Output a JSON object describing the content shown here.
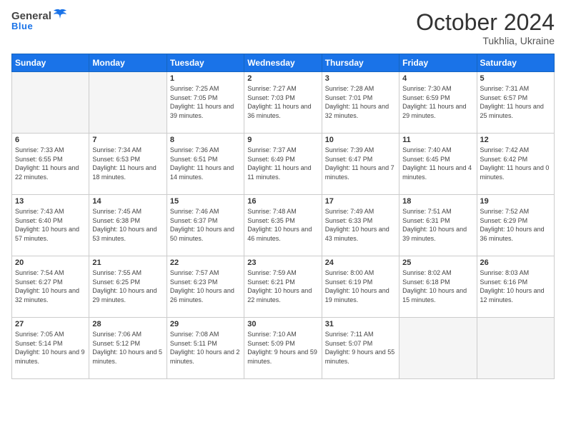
{
  "header": {
    "logo_general": "General",
    "logo_blue": "Blue",
    "month": "October 2024",
    "location": "Tukhlia, Ukraine"
  },
  "weekdays": [
    "Sunday",
    "Monday",
    "Tuesday",
    "Wednesday",
    "Thursday",
    "Friday",
    "Saturday"
  ],
  "weeks": [
    [
      {
        "day": "",
        "info": ""
      },
      {
        "day": "",
        "info": ""
      },
      {
        "day": "1",
        "info": "Sunrise: 7:25 AM\nSunset: 7:05 PM\nDaylight: 11 hours\nand 39 minutes."
      },
      {
        "day": "2",
        "info": "Sunrise: 7:27 AM\nSunset: 7:03 PM\nDaylight: 11 hours\nand 36 minutes."
      },
      {
        "day": "3",
        "info": "Sunrise: 7:28 AM\nSunset: 7:01 PM\nDaylight: 11 hours\nand 32 minutes."
      },
      {
        "day": "4",
        "info": "Sunrise: 7:30 AM\nSunset: 6:59 PM\nDaylight: 11 hours\nand 29 minutes."
      },
      {
        "day": "5",
        "info": "Sunrise: 7:31 AM\nSunset: 6:57 PM\nDaylight: 11 hours\nand 25 minutes."
      }
    ],
    [
      {
        "day": "6",
        "info": "Sunrise: 7:33 AM\nSunset: 6:55 PM\nDaylight: 11 hours\nand 22 minutes."
      },
      {
        "day": "7",
        "info": "Sunrise: 7:34 AM\nSunset: 6:53 PM\nDaylight: 11 hours\nand 18 minutes."
      },
      {
        "day": "8",
        "info": "Sunrise: 7:36 AM\nSunset: 6:51 PM\nDaylight: 11 hours\nand 14 minutes."
      },
      {
        "day": "9",
        "info": "Sunrise: 7:37 AM\nSunset: 6:49 PM\nDaylight: 11 hours\nand 11 minutes."
      },
      {
        "day": "10",
        "info": "Sunrise: 7:39 AM\nSunset: 6:47 PM\nDaylight: 11 hours\nand 7 minutes."
      },
      {
        "day": "11",
        "info": "Sunrise: 7:40 AM\nSunset: 6:45 PM\nDaylight: 11 hours\nand 4 minutes."
      },
      {
        "day": "12",
        "info": "Sunrise: 7:42 AM\nSunset: 6:42 PM\nDaylight: 11 hours\nand 0 minutes."
      }
    ],
    [
      {
        "day": "13",
        "info": "Sunrise: 7:43 AM\nSunset: 6:40 PM\nDaylight: 10 hours\nand 57 minutes."
      },
      {
        "day": "14",
        "info": "Sunrise: 7:45 AM\nSunset: 6:38 PM\nDaylight: 10 hours\nand 53 minutes."
      },
      {
        "day": "15",
        "info": "Sunrise: 7:46 AM\nSunset: 6:37 PM\nDaylight: 10 hours\nand 50 minutes."
      },
      {
        "day": "16",
        "info": "Sunrise: 7:48 AM\nSunset: 6:35 PM\nDaylight: 10 hours\nand 46 minutes."
      },
      {
        "day": "17",
        "info": "Sunrise: 7:49 AM\nSunset: 6:33 PM\nDaylight: 10 hours\nand 43 minutes."
      },
      {
        "day": "18",
        "info": "Sunrise: 7:51 AM\nSunset: 6:31 PM\nDaylight: 10 hours\nand 39 minutes."
      },
      {
        "day": "19",
        "info": "Sunrise: 7:52 AM\nSunset: 6:29 PM\nDaylight: 10 hours\nand 36 minutes."
      }
    ],
    [
      {
        "day": "20",
        "info": "Sunrise: 7:54 AM\nSunset: 6:27 PM\nDaylight: 10 hours\nand 32 minutes."
      },
      {
        "day": "21",
        "info": "Sunrise: 7:55 AM\nSunset: 6:25 PM\nDaylight: 10 hours\nand 29 minutes."
      },
      {
        "day": "22",
        "info": "Sunrise: 7:57 AM\nSunset: 6:23 PM\nDaylight: 10 hours\nand 26 minutes."
      },
      {
        "day": "23",
        "info": "Sunrise: 7:59 AM\nSunset: 6:21 PM\nDaylight: 10 hours\nand 22 minutes."
      },
      {
        "day": "24",
        "info": "Sunrise: 8:00 AM\nSunset: 6:19 PM\nDaylight: 10 hours\nand 19 minutes."
      },
      {
        "day": "25",
        "info": "Sunrise: 8:02 AM\nSunset: 6:18 PM\nDaylight: 10 hours\nand 15 minutes."
      },
      {
        "day": "26",
        "info": "Sunrise: 8:03 AM\nSunset: 6:16 PM\nDaylight: 10 hours\nand 12 minutes."
      }
    ],
    [
      {
        "day": "27",
        "info": "Sunrise: 7:05 AM\nSunset: 5:14 PM\nDaylight: 10 hours\nand 9 minutes."
      },
      {
        "day": "28",
        "info": "Sunrise: 7:06 AM\nSunset: 5:12 PM\nDaylight: 10 hours\nand 5 minutes."
      },
      {
        "day": "29",
        "info": "Sunrise: 7:08 AM\nSunset: 5:11 PM\nDaylight: 10 hours\nand 2 minutes."
      },
      {
        "day": "30",
        "info": "Sunrise: 7:10 AM\nSunset: 5:09 PM\nDaylight: 9 hours\nand 59 minutes."
      },
      {
        "day": "31",
        "info": "Sunrise: 7:11 AM\nSunset: 5:07 PM\nDaylight: 9 hours\nand 55 minutes."
      },
      {
        "day": "",
        "info": ""
      },
      {
        "day": "",
        "info": ""
      }
    ]
  ]
}
